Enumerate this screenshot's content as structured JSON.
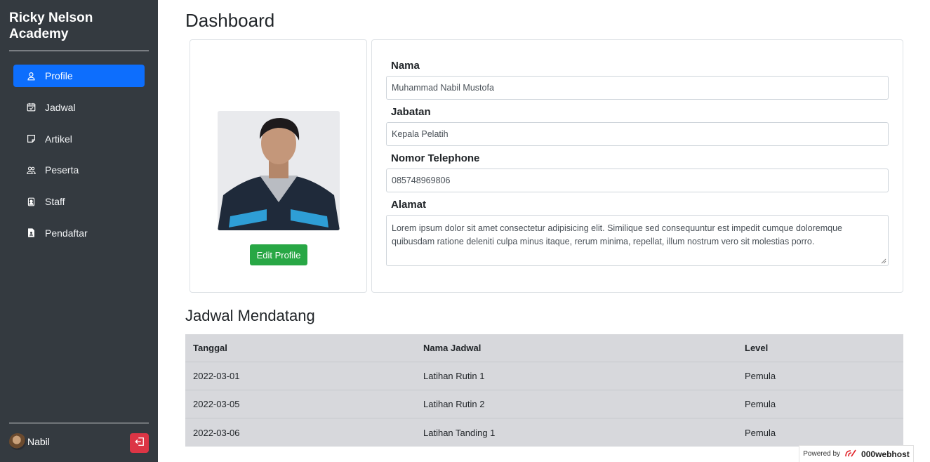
{
  "sidebar": {
    "brand": "Ricky Nelson Academy",
    "items": [
      {
        "label": "Profile",
        "icon": "person-icon",
        "active": true
      },
      {
        "label": "Jadwal",
        "icon": "calendar-check-icon"
      },
      {
        "label": "Artikel",
        "icon": "sticky-note-icon"
      },
      {
        "label": "Peserta",
        "icon": "people-icon"
      },
      {
        "label": "Staff",
        "icon": "person-badge-icon"
      },
      {
        "label": "Pendaftar",
        "icon": "file-person-icon"
      }
    ],
    "user_name": "Nabil",
    "logout_icon": "logout-icon"
  },
  "main": {
    "title": "Dashboard",
    "profile": {
      "edit_label": "Edit Profile",
      "fields": {
        "nama_label": "Nama",
        "nama_value": "Muhammad Nabil Mustofa",
        "jabatan_label": "Jabatan",
        "jabatan_value": "Kepala Pelatih",
        "telp_label": "Nomor Telephone",
        "telp_value": "085748969806",
        "alamat_label": "Alamat",
        "alamat_value": "Lorem ipsum dolor sit amet consectetur adipisicing elit. Similique sed consequuntur est impedit cumque doloremque quibusdam ratione deleniti culpa minus itaque, rerum minima, repellat, illum nostrum vero sit molestias porro."
      }
    },
    "schedule": {
      "title": "Jadwal Mendatang",
      "headers": [
        "Tanggal",
        "Nama Jadwal",
        "Level"
      ],
      "rows": [
        [
          "2022-03-01",
          "Latihan Rutin 1",
          "Pemula"
        ],
        [
          "2022-03-05",
          "Latihan Rutin 2",
          "Pemula"
        ],
        [
          "2022-03-06",
          "Latihan Tanding 1",
          "Pemula"
        ]
      ]
    }
  },
  "footer_badge": {
    "prefix": "Powered by",
    "brand": "000webhost"
  },
  "colors": {
    "sidebar": "#343a40",
    "primary": "#0d6efd",
    "success": "#28a745",
    "danger": "#dc3545",
    "table": "#d7d8dc"
  }
}
